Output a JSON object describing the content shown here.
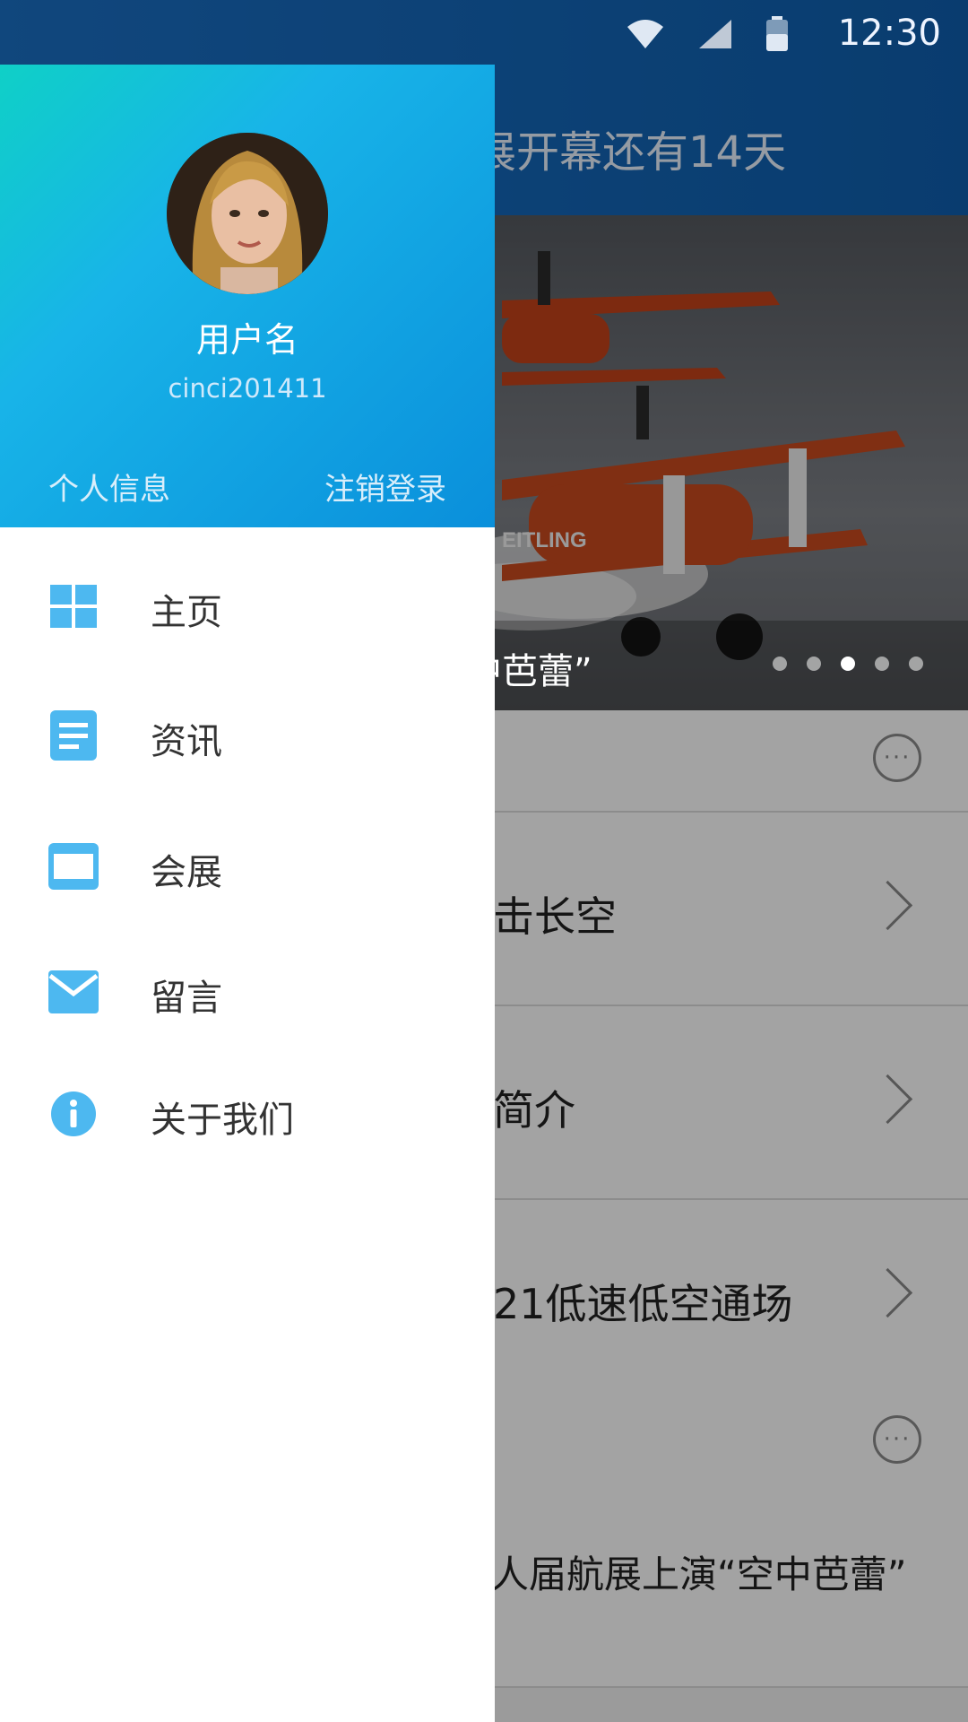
{
  "status_bar": {
    "time": "12:30"
  },
  "background": {
    "title": "展开幕还有14天",
    "banner_caption": "中芭蕾”",
    "banner_dots": 5,
    "banner_active_index": 2,
    "rows": [
      "击长空",
      "简介",
      "21低速低空通场"
    ],
    "news_title": "人届航展上演“空中芭蕾”"
  },
  "drawer": {
    "username": "用户名",
    "user_id": "cinci201411",
    "profile_link": "个人信息",
    "logout_link": "注销登录",
    "items": [
      {
        "label": "主页",
        "icon": "grid-icon"
      },
      {
        "label": "资讯",
        "icon": "article-icon"
      },
      {
        "label": "会展",
        "icon": "display-icon"
      },
      {
        "label": "留言",
        "icon": "mail-icon"
      },
      {
        "label": "关于我们",
        "icon": "info-icon"
      }
    ]
  },
  "colors": {
    "accent": "#4db8f0",
    "drawer_gradient_start": "#0fd0c7",
    "drawer_gradient_end": "#0a8fdb"
  }
}
